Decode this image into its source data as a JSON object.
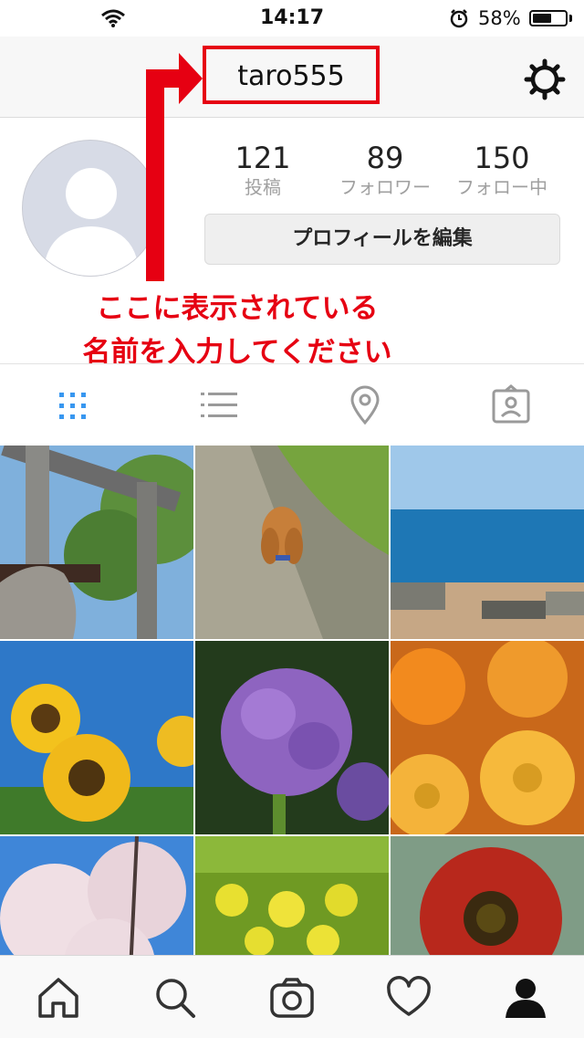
{
  "status_bar": {
    "time": "14:17",
    "battery_percent": "58%",
    "battery_level": 0.58
  },
  "header": {
    "username": "taro555"
  },
  "profile": {
    "stats": [
      {
        "count": "121",
        "label": "投稿"
      },
      {
        "count": "89",
        "label": "フォロワー"
      },
      {
        "count": "150",
        "label": "フォロー中"
      }
    ],
    "edit_button_label": "プロフィールを編集"
  },
  "annotation": {
    "line1": "ここに表示されている",
    "line2": "名前を入力してください",
    "color": "#e60012"
  },
  "tabs": [
    {
      "icon": "grid-icon",
      "active": true
    },
    {
      "icon": "list-icon",
      "active": false
    },
    {
      "icon": "location-pin-icon",
      "active": false
    },
    {
      "icon": "tagged-photos-icon",
      "active": false
    }
  ],
  "photos": [
    "torii-gate-photo",
    "dachshund-photo",
    "seaside-town-photo",
    "sunflowers-photo",
    "hydrangea-photo",
    "orange-chrysanthemums-photo",
    "cherry-blossoms-photo",
    "rapeseed-field-photo",
    "red-sunflower-photo"
  ],
  "bottom_nav": [
    "home-icon",
    "search-icon",
    "camera-icon",
    "heart-icon",
    "profile-icon"
  ],
  "colors": {
    "accent_blue": "#3897f0",
    "annotation_red": "#e60012"
  }
}
